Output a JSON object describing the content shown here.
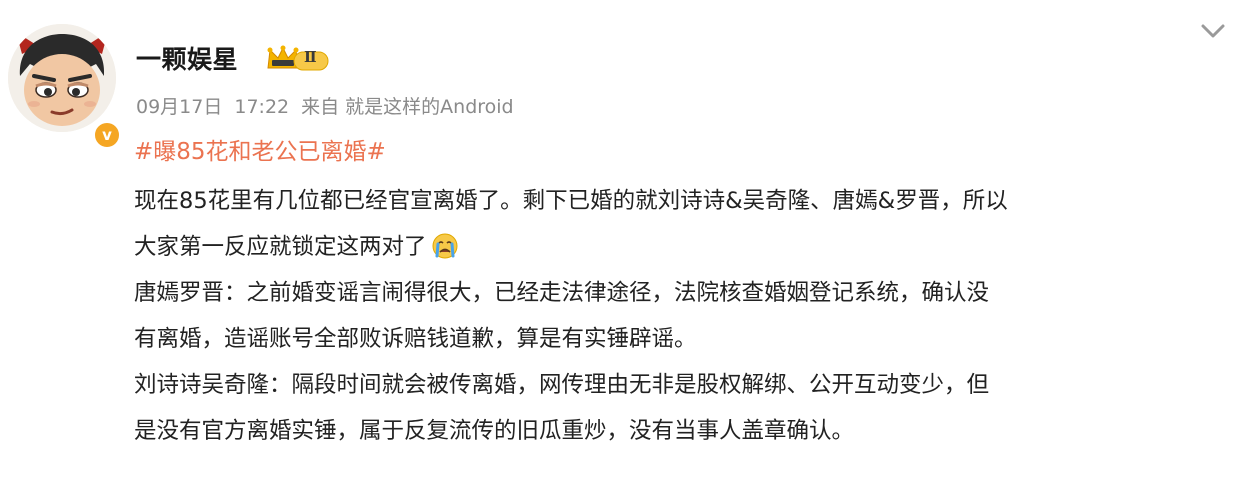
{
  "post": {
    "username": "一颗娱星",
    "vip_level": "Ⅱ",
    "verified_mark": "v",
    "date": "09月17日",
    "time": "17:22",
    "source": "来自 就是这样的Android",
    "hashtag": "#曝85花和老公已离婚#",
    "lines": [
      "现在85花里有几位都已经官宣离婚了。剩下已婚的就刘诗诗&吴奇隆、唐嫣&罗晋，所以",
      "大家第一反应就锁定这两对了",
      "唐嫣罗晋：之前婚变谣言闹得很大，已经走法律途径，法院核查婚姻登记系统，确认没",
      "有离婚，造谣账号全部败诉赔钱道歉，算是有实锤辟谣。",
      "刘诗诗吴奇隆：隔段时间就会被传离婚，网传理由无非是股权解绑、公开互动变少，但",
      "是没有官方离婚实锤，属于反复流传的旧瓜重炒，没有当事人盖章确认。"
    ],
    "emoji": "crying-face-icon"
  },
  "colors": {
    "hashtag": "#eb7350",
    "meta": "#8a8a8a",
    "text": "#222222",
    "verified": "#f5a623"
  }
}
